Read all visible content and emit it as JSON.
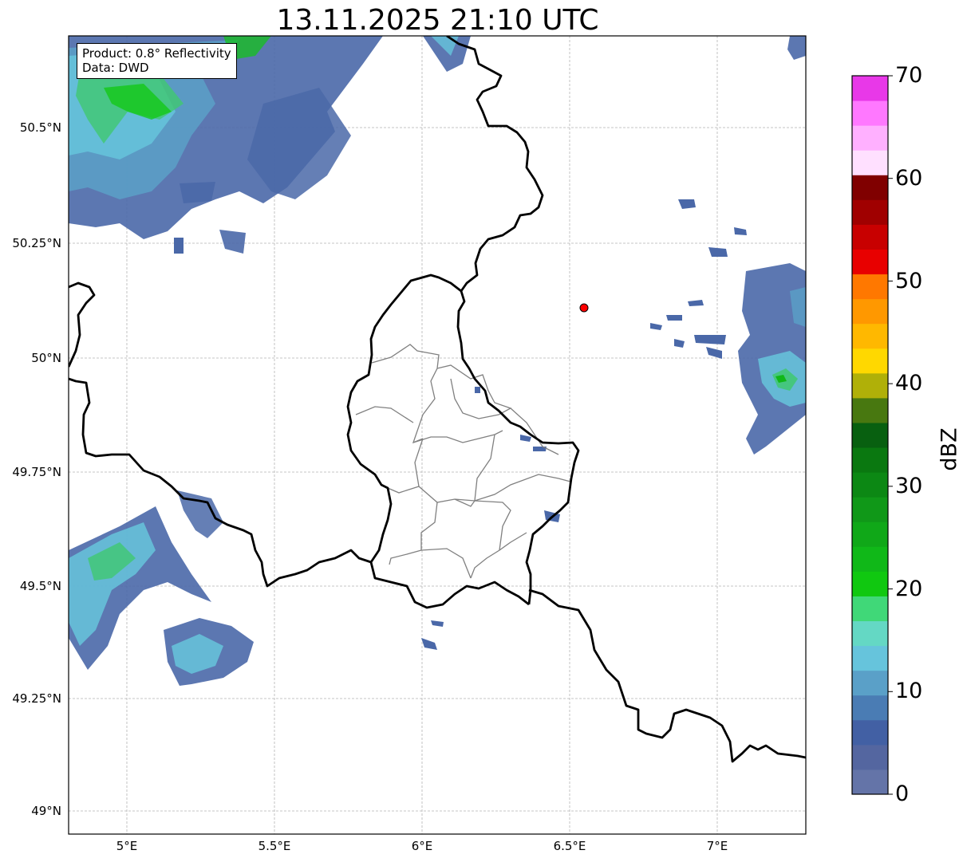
{
  "title": "13.11.2025 21:10 UTC",
  "info_box": {
    "product": "Product: 0.8° Reflectivity",
    "data": "Data: DWD"
  },
  "lat_labels": [
    "50.5°N",
    "50.25°N",
    "50°N",
    "49.75°N",
    "49.5°N",
    "49.25°N",
    "49°N"
  ],
  "lon_labels": [
    "5°E",
    "5.5°E",
    "6°E",
    "6.5°E",
    "7°E"
  ],
  "colorbar": {
    "unit": "dBZ",
    "min": 0,
    "max": 70,
    "tick_labels": [
      "0",
      "10",
      "20",
      "30",
      "40",
      "50",
      "60",
      "70"
    ],
    "colors": [
      "#6474a8",
      "#5466a0",
      "#4260a4",
      "#4a7cb4",
      "#5aa0c8",
      "#66c4dc",
      "#64d8c4",
      "#40d878",
      "#10c810",
      "#10b818",
      "#10a818",
      "#109818",
      "#0c8814",
      "#0a7810",
      "#086010",
      "#487810",
      "#b0b008",
      "#ffd800",
      "#ffb800",
      "#ff9800",
      "#ff7800",
      "#e80000",
      "#c80000",
      "#a00000",
      "#800000",
      "#ffe0ff",
      "#ffb0ff",
      "#ff78ff",
      "#e838e8"
    ]
  },
  "radar_site_color": "#ff0000"
}
